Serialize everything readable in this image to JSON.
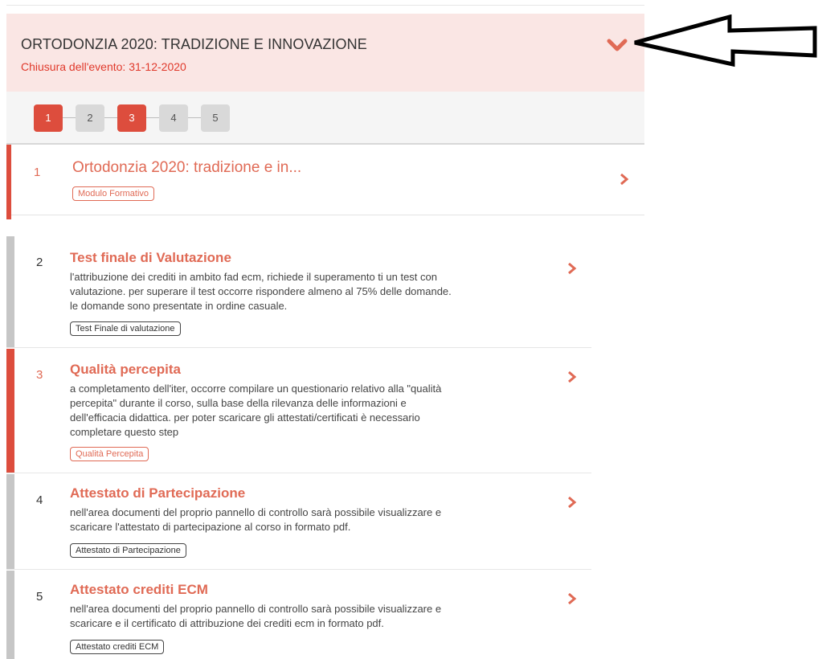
{
  "event": {
    "title": "ORTODONZIA 2020: TRADIZIONE E INNOVAZIONE",
    "closing": "Chiusura dell'evento: 31-12-2020",
    "accent_color": "#dd4d3d",
    "toggle_icon": "chevron-down-icon"
  },
  "steps": [
    {
      "label": "1",
      "status": "done"
    },
    {
      "label": "2",
      "status": "todo"
    },
    {
      "label": "3",
      "status": "done"
    },
    {
      "label": "4",
      "status": "todo"
    },
    {
      "label": "5",
      "status": "todo"
    }
  ],
  "items": [
    {
      "num": "1",
      "title": "Ortodonzia 2020: tradizione e in...",
      "tag": "Modulo Formativo",
      "state": "done"
    },
    {
      "num": "2",
      "title": "Test finale di Valutazione",
      "desc": [
        "l'attribuzione dei crediti in ambito fad ecm, richiede il superamento ti un test con",
        "valutazione. per superare il test occorre rispondere almeno al 75% delle domande.",
        "le domande sono presentate in ordine casuale."
      ],
      "tag": "Test Finale di valutazione",
      "state": "todo"
    },
    {
      "num": "3",
      "title": "Qualità percepita",
      "desc": [
        "a completamento dell'iter, occorre compilare un questionario relativo alla \"qualità",
        "percepita\" durante il corso, sulla base della rilevanza delle informazioni e",
        "dell'efficacia didattica. per poter scaricare gli attestati/certificati è necessario",
        "completare questo step"
      ],
      "tag": "Qualità Percepita",
      "state": "done"
    },
    {
      "num": "4",
      "title": "Attestato di Partecipazione",
      "desc": [
        "nell'area documenti del proprio pannello di controllo sarà possibile visualizzare e",
        "scaricare l'attestato di partecipazione al corso in formato pdf."
      ],
      "tag": "Attestato di Partecipazione",
      "state": "todo"
    },
    {
      "num": "5",
      "title": "Attestato crediti ECM",
      "desc": [
        "nell'area documenti del proprio pannello di controllo sarà possibile visualizzare e",
        "scaricare e il certificato di attribuzione dei crediti ecm in formato pdf."
      ],
      "tag": "Attestato crediti ECM",
      "state": "todo"
    }
  ]
}
